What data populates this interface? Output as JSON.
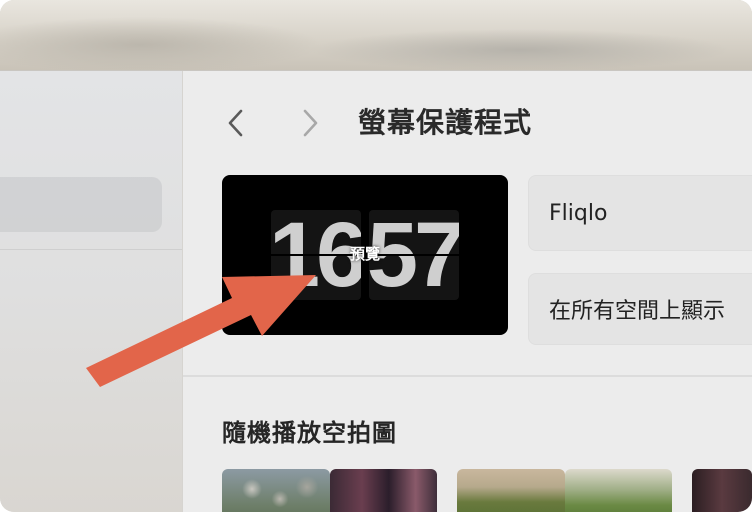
{
  "header": {
    "title": "螢幕保護程式",
    "back_icon": "chevron-left-icon",
    "forward_icon": "chevron-right-icon"
  },
  "preview": {
    "hours": "16",
    "minutes": "57",
    "label": "預覽"
  },
  "settings": {
    "screen_saver_value": "Fliqlo",
    "display_option_value": "在所有空間上顯示"
  },
  "section": {
    "title": "隨機播放空拍圖"
  },
  "colors": {
    "annotation_arrow": "#e2654a",
    "preview_background": "#000000"
  }
}
